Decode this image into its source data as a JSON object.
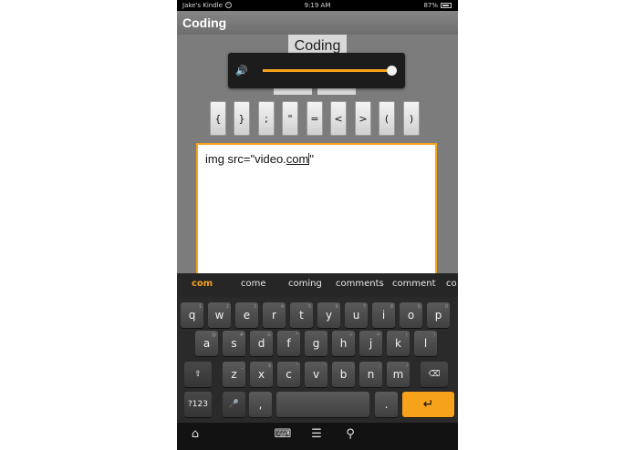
{
  "status_bar": {
    "device_name": "Jake's Kindle",
    "time": "9:19 AM",
    "battery": "87%"
  },
  "app": {
    "title": "Coding"
  },
  "coding_button": {
    "label": "Coding"
  },
  "volume": {
    "level": 0.98,
    "accent": "#f7a21b"
  },
  "symbol_keys": [
    "{",
    "}",
    ";",
    "\"",
    "=",
    "<",
    ">",
    "(",
    ")"
  ],
  "editor": {
    "text_before": "img src=\"video.",
    "underlined": "com",
    "text_after": "\""
  },
  "suggestions": [
    "com",
    "come",
    "coming",
    "comments",
    "comment",
    "co"
  ],
  "keyboard": {
    "row1": [
      {
        "label": "q",
        "hint": "1"
      },
      {
        "label": "w",
        "hint": "2"
      },
      {
        "label": "e",
        "hint": "3"
      },
      {
        "label": "r",
        "hint": "4"
      },
      {
        "label": "t",
        "hint": "5"
      },
      {
        "label": "y",
        "hint": "6"
      },
      {
        "label": "u",
        "hint": "7"
      },
      {
        "label": "i",
        "hint": "8"
      },
      {
        "label": "o",
        "hint": "9"
      },
      {
        "label": "p",
        "hint": "0"
      }
    ],
    "row2": [
      {
        "label": "a",
        "hint": "@"
      },
      {
        "label": "s",
        "hint": "#"
      },
      {
        "label": "d",
        "hint": "&"
      },
      {
        "label": "f",
        "hint": "*"
      },
      {
        "label": "g",
        "hint": "-"
      },
      {
        "label": "h",
        "hint": "+"
      },
      {
        "label": "j",
        "hint": "="
      },
      {
        "label": "k",
        "hint": "("
      },
      {
        "label": "l",
        "hint": ")"
      }
    ],
    "row3": [
      {
        "label": "z",
        "hint": "_"
      },
      {
        "label": "x",
        "hint": "$"
      },
      {
        "label": "c",
        "hint": "\""
      },
      {
        "label": "v",
        "hint": "'"
      },
      {
        "label": "b",
        "hint": ":"
      },
      {
        "label": "n",
        "hint": ";"
      },
      {
        "label": "m",
        "hint": "/"
      }
    ],
    "shift_icon": "shift-icon",
    "backspace_icon": "backspace-icon",
    "mode_label": "?123",
    "mic_icon": "microphone-icon",
    "comma_label": ",",
    "period_label": ".",
    "enter_icon": "enter-icon"
  },
  "nav_icons": [
    "home-icon",
    "keyboard-hide-icon",
    "menu-icon",
    "search-icon"
  ]
}
